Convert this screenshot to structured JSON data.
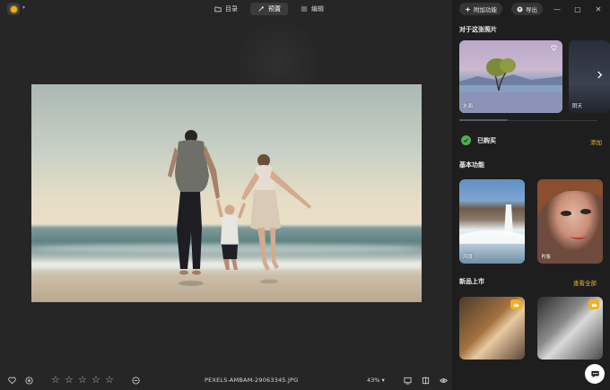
{
  "header": {
    "tabs": [
      {
        "label": "目录",
        "icon": "folder-icon"
      },
      {
        "label": "预置",
        "icon": "magic-wand-icon"
      },
      {
        "label": "编辑",
        "icon": "sliders-icon"
      }
    ],
    "active_tab": 1,
    "addon_label": "附加功能",
    "export_label": "导出",
    "accent": "#f2b01e"
  },
  "panel": {
    "about_title": "对于这张照片",
    "about_cards": [
      {
        "label": "水面"
      },
      {
        "label": "阴天"
      }
    ],
    "purchased_label": "已购买",
    "add_label": "添加",
    "basic_title": "基本功能",
    "basic_cards": [
      {
        "label": "风景"
      },
      {
        "label": "肖像"
      }
    ],
    "new_title": "新品上市",
    "view_all_label": "查看全部"
  },
  "bottom": {
    "rating": 0,
    "filename": "PEXELS-AMBAM-29063345.JPG",
    "zoom": "43%"
  }
}
